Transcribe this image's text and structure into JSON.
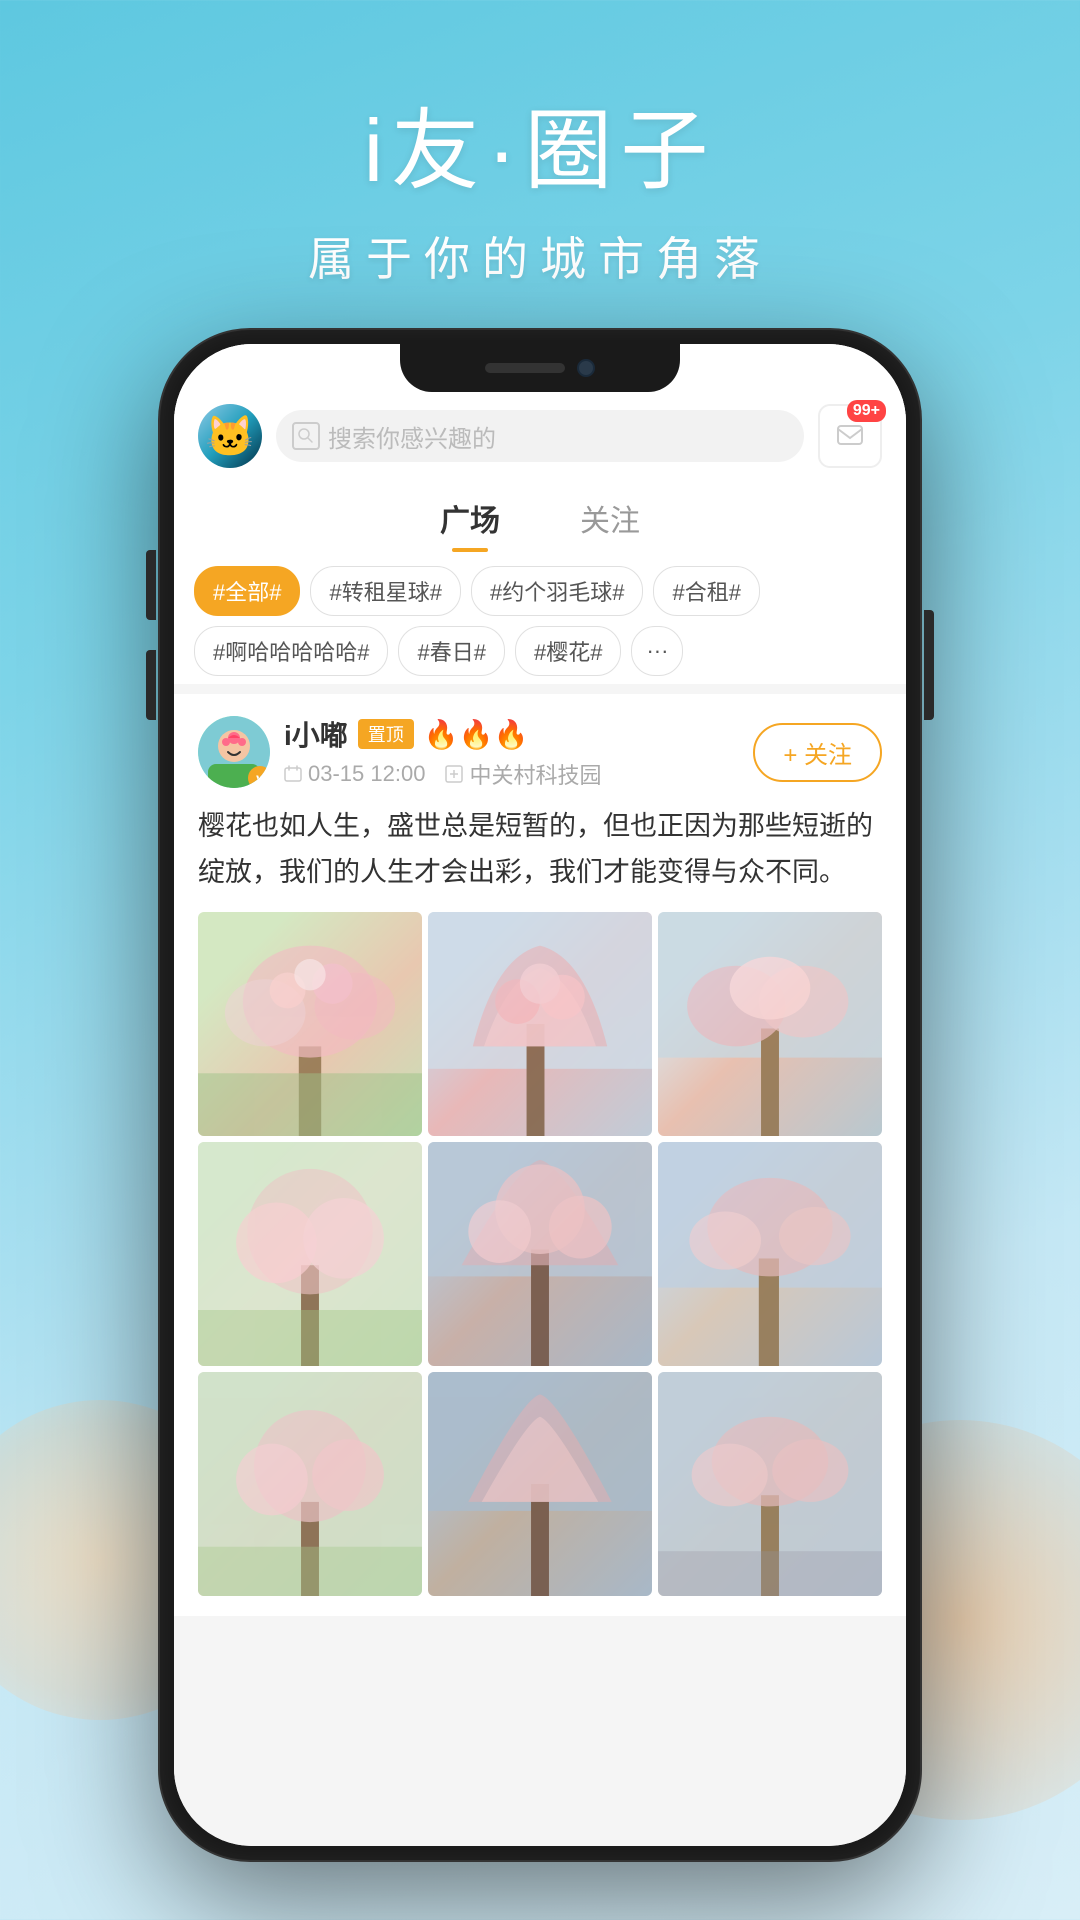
{
  "background": {
    "gradient_start": "#5ec8e0",
    "gradient_end": "#c5e8f5"
  },
  "header": {
    "title": "i友·圈子",
    "subtitle": "属于你的城市角落"
  },
  "phone": {
    "search_placeholder": "搜索你感兴趣的",
    "notification_badge": "99+",
    "tabs": [
      {
        "label": "广场",
        "active": true
      },
      {
        "label": "关注",
        "active": false
      }
    ],
    "tags": [
      {
        "label": "#全部#",
        "active": true
      },
      {
        "label": "#转租星球#",
        "active": false
      },
      {
        "label": "#约个羽毛球#",
        "active": false
      },
      {
        "label": "#合租#",
        "active": false
      },
      {
        "label": "#啊哈哈哈哈哈#",
        "active": false
      },
      {
        "label": "#春日#",
        "active": false
      },
      {
        "label": "#樱花#",
        "active": false
      }
    ],
    "post": {
      "username": "i小嘟",
      "pin_label": "置顶",
      "fire_icons": "🔥🔥🔥",
      "time": "03-15 12:00",
      "location": "中关村科技园",
      "follow_label": "+ 关注",
      "content": "樱花也如人生，盛世总是短暂的，但也正因为那些短逝的绽放，我们的人生才会出彩，我们才能变得与众不同。",
      "images": [
        {
          "id": 1,
          "type": "cherry-1"
        },
        {
          "id": 2,
          "type": "cherry-2"
        },
        {
          "id": 3,
          "type": "cherry-3"
        },
        {
          "id": 4,
          "type": "cherry-4"
        },
        {
          "id": 5,
          "type": "cherry-5"
        },
        {
          "id": 6,
          "type": "cherry-6"
        },
        {
          "id": 7,
          "type": "cherry-7"
        },
        {
          "id": 8,
          "type": "cherry-8"
        },
        {
          "id": 9,
          "type": "cherry-9"
        }
      ]
    }
  }
}
